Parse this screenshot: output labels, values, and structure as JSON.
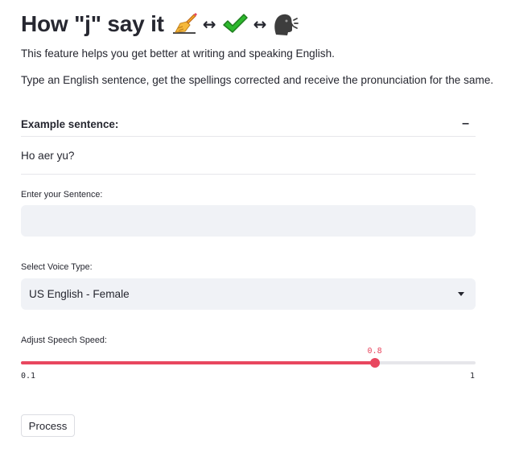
{
  "header": {
    "title": "How \"j\" say it",
    "arrow_1": "↔",
    "arrow_2": "↔",
    "icons": [
      "writing-hand-icon",
      "check-mark-icon",
      "speaking-head-icon"
    ]
  },
  "description": {
    "line1": "This feature helps you get better at writing and speaking English.",
    "line2": "Type an English sentence, get the spellings corrected and receive the pronunciation for the same."
  },
  "example": {
    "label": "Example sentence:",
    "toggle": "–",
    "sentence": "Ho aer yu?"
  },
  "sentence_input": {
    "label": "Enter your Sentence:",
    "value": "",
    "placeholder": ""
  },
  "voice_select": {
    "label": "Select Voice Type:",
    "selected": "US English - Female"
  },
  "speed_slider": {
    "label": "Adjust Speech Speed:",
    "value": "0.8",
    "min": "0.1",
    "max": "1",
    "fraction": 0.778
  },
  "actions": {
    "process_label": "Process"
  },
  "colors": {
    "accent": "#e8475f",
    "input_bg": "#f0f2f6",
    "text": "#262730"
  }
}
